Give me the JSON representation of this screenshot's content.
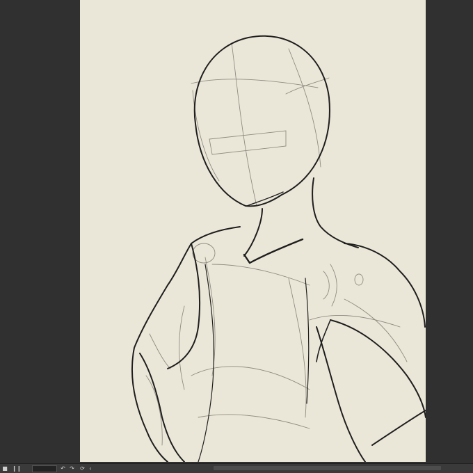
{
  "canvas": {
    "background": "#ebe7d8",
    "drawing": "figure-sketch",
    "stroke_color": "#1e1e1e",
    "guide_color": "#8f8b80"
  },
  "statusbar": {
    "zoom_value": "",
    "icons": [
      "square-icon",
      "pause-icon",
      "rotate-left-icon",
      "rotate-right-icon",
      "reset-rotation-icon",
      "chevron-left-icon"
    ]
  },
  "colors": {
    "workspace": "#303030",
    "statusbar": "#3a3a3a"
  }
}
